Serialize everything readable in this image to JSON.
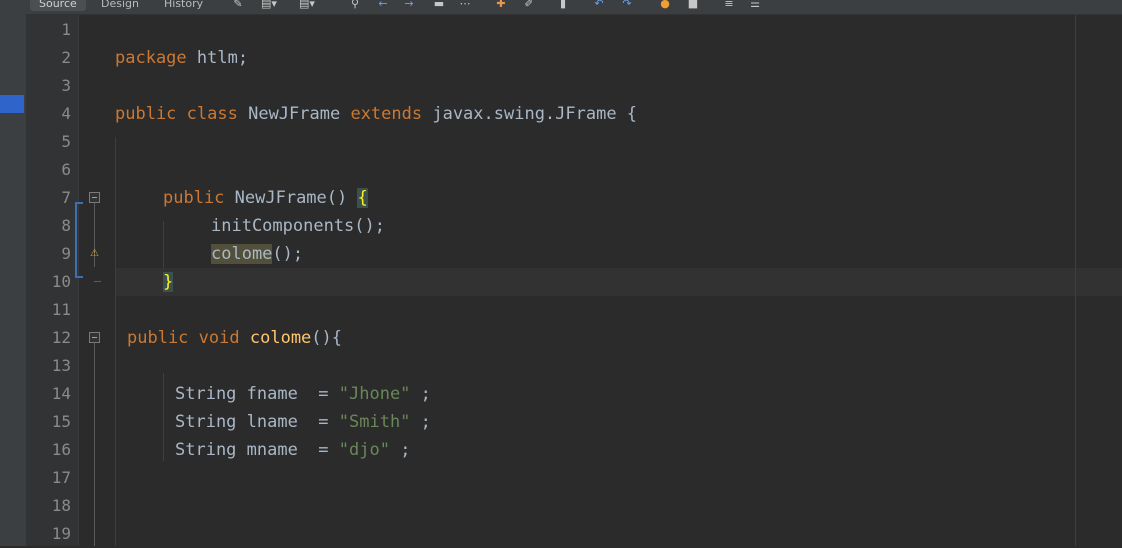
{
  "toolbar": {
    "tabs": [
      {
        "label": "Source",
        "active": true
      },
      {
        "label": "Design",
        "active": false
      },
      {
        "label": "History",
        "active": false
      }
    ],
    "icons": [
      "last-edit-icon",
      "back-dropdown-icon",
      "forward-dropdown-icon",
      "find-icon",
      "find-previous-icon",
      "find-next-icon",
      "toggle-highlight-icon",
      "toggle-rectangular-selection-icon",
      "shift-line-left-icon",
      "shift-line-right-icon",
      "start-macro-icon",
      "stop-macro-icon",
      "comment-icon",
      "uncomment-icon"
    ]
  },
  "editor": {
    "line_numbers": [
      "1",
      "2",
      "3",
      "4",
      "5",
      "6",
      "7",
      "8",
      "9",
      "10",
      "11",
      "12",
      "13",
      "14",
      "15",
      "16",
      "17",
      "18",
      "19"
    ],
    "line9_has_warning": true,
    "colors": {
      "keyword": "#cc7832",
      "method": "#ffc66d",
      "string": "#6a8759",
      "text": "#a9b7c6",
      "background": "#2b2b2b"
    },
    "code": {
      "l2": {
        "kw": "package",
        "rest": " htlm;"
      },
      "l4": {
        "kw1": "public",
        "sp1": " ",
        "kw2": "class",
        "name": " NewJFrame ",
        "kw3": "extends",
        "rest": " javax.swing.JFrame {"
      },
      "l7": {
        "kw": "public",
        "rest": " NewJFrame() ",
        "brace": "{"
      },
      "l8": {
        "text": "initComponents();"
      },
      "l9": {
        "hl": "colome",
        "rest": "();"
      },
      "l10": {
        "brace": "}"
      },
      "l12": {
        "kw1": "public",
        "sp": " ",
        "kw2": "void",
        "sp2": " ",
        "fn": "colome",
        "rest": "(){"
      },
      "l14": {
        "pre": "String fname  = ",
        "str": "\"Jhone\"",
        "post": " ;"
      },
      "l15": {
        "pre": "String lname  = ",
        "str": "\"Smith\"",
        "post": " ;"
      },
      "l16": {
        "pre": "String mname  = ",
        "str": "\"djo\"",
        "post": " ;"
      }
    }
  }
}
